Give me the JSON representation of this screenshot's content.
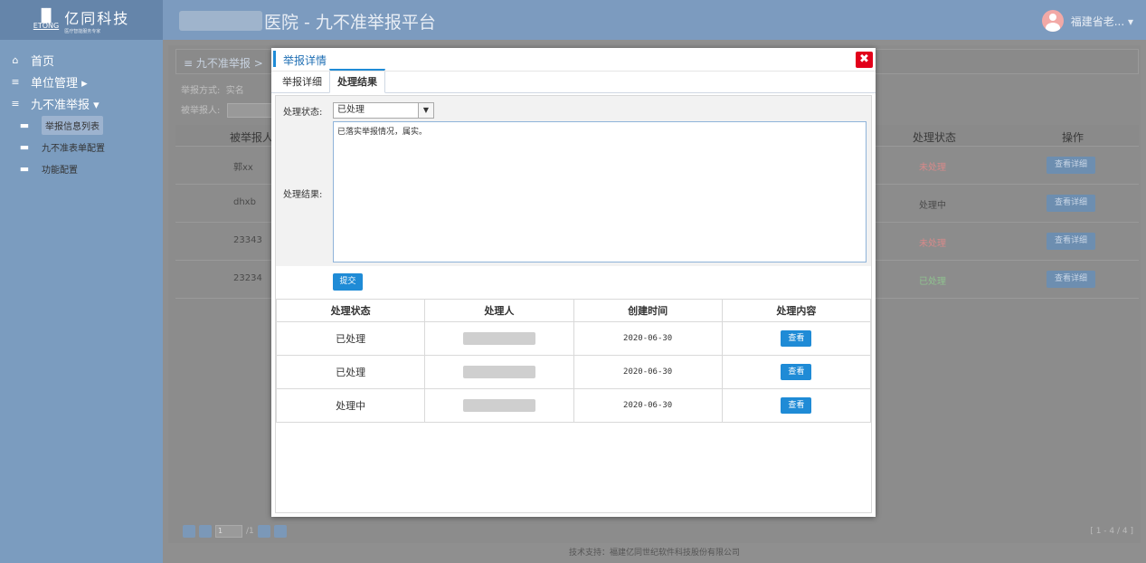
{
  "brand": {
    "name": "亿同科技",
    "en": "ETONG",
    "tagline": "医疗智能服务专家"
  },
  "header": {
    "title": "医院 - 九不准举报平台",
    "user": "福建省老... ▾"
  },
  "sidebar": {
    "items": [
      {
        "label": "首页",
        "icon": "home-icon",
        "glyph": "⌂"
      },
      {
        "label": "单位管理 ▸",
        "icon": "list-icon",
        "glyph": "≡"
      },
      {
        "label": "九不准举报 ▾",
        "icon": "list-icon",
        "glyph": "≡"
      }
    ],
    "sub": [
      {
        "label": "举报信息列表",
        "icon": "list-icon",
        "glyph": "▬"
      },
      {
        "label": "九不准表单配置",
        "icon": "list-icon",
        "glyph": "▬"
      },
      {
        "label": "功能配置",
        "icon": "list-icon",
        "glyph": "▬"
      }
    ]
  },
  "breadcrumb": {
    "icon": "≡",
    "text": "九不准举报",
    "sep": ">"
  },
  "filters": {
    "method_label": "举报方式:",
    "method_value": "实名",
    "person_label": "被举报人:"
  },
  "bg_table": {
    "headers": [
      "被举报人",
      "处理状态",
      "操作"
    ],
    "rows": [
      {
        "person": "郭xx",
        "status": "未处理",
        "action": "查看详细"
      },
      {
        "person": "dhxb",
        "status": "处理中",
        "action": "查看详细"
      },
      {
        "person": "23343",
        "status": "未处理",
        "action": "查看详细"
      },
      {
        "person": "23234",
        "status": "已处理",
        "action": "查看详细"
      }
    ]
  },
  "pager": {
    "page": "1",
    "total": "/1",
    "count": "[ 1 - 4 / 4 ]"
  },
  "footer": "技术支持：福建亿同世纪软件科技股份有限公司",
  "modal": {
    "title": "举报详情",
    "close": "✖",
    "tabs": [
      "举报详细",
      "处理结果"
    ],
    "status_label": "处理状态:",
    "status_value": "已处理",
    "result_label": "处理结果:",
    "result_text": "已落实举报情况，属实。",
    "submit": "提交",
    "history": {
      "headers": [
        "处理状态",
        "处理人",
        "创建时间",
        "处理内容"
      ],
      "rows": [
        {
          "status": "已处理",
          "date": "2020-06-30",
          "action": "查看"
        },
        {
          "status": "已处理",
          "date": "2020-06-30",
          "action": "查看"
        },
        {
          "status": "处理中",
          "date": "2020-06-30",
          "action": "查看"
        }
      ]
    }
  }
}
